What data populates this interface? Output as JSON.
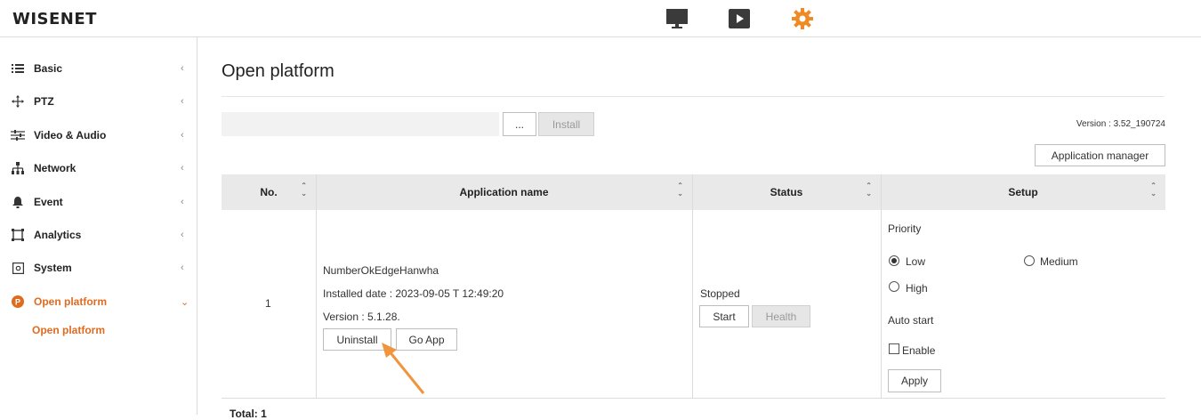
{
  "header": {
    "logo": "WISENET",
    "nav_icons": [
      "monitor-icon",
      "play-icon",
      "gear-icon"
    ],
    "accent_color": "#f08a24"
  },
  "sidebar": {
    "items": [
      {
        "label": "Basic",
        "icon": "list-icon"
      },
      {
        "label": "PTZ",
        "icon": "ptz-move-icon"
      },
      {
        "label": "Video & Audio",
        "icon": "sliders-icon"
      },
      {
        "label": "Network",
        "icon": "network-icon"
      },
      {
        "label": "Event",
        "icon": "bell-icon"
      },
      {
        "label": "Analytics",
        "icon": "analytics-frame-icon"
      },
      {
        "label": "System",
        "icon": "system-icon"
      },
      {
        "label": "Open platform",
        "icon": "open-platform-icon"
      }
    ],
    "sub_item": "Open platform",
    "active_color": "#e06b1f"
  },
  "main": {
    "title": "Open platform",
    "browse_label": "...",
    "install_label": "Install",
    "version": "Version : 3.52_190724",
    "app_manager_label": "Application manager",
    "table": {
      "headers": [
        "No.",
        "Application name",
        "Status",
        "Setup"
      ],
      "rows": [
        {
          "no": "1",
          "app_name": "NumberOkEdgeHanwha",
          "installed_date": "Installed date : 2023-09-05 T 12:49:20",
          "version": "Version : 5.1.28.",
          "uninstall_label": "Uninstall",
          "go_app_label": "Go App",
          "status": "Stopped",
          "start_label": "Start",
          "health_label": "Health",
          "priority_label": "Priority",
          "priority_options": [
            "Low",
            "Medium",
            "High"
          ],
          "priority_selected": "Low",
          "auto_start_label": "Auto start",
          "enable_label": "Enable",
          "apply_label": "Apply"
        }
      ],
      "total": "Total: 1"
    }
  },
  "annotation": {
    "type": "arrow",
    "color": "#f0953e",
    "points_to": "uninstall-button"
  }
}
